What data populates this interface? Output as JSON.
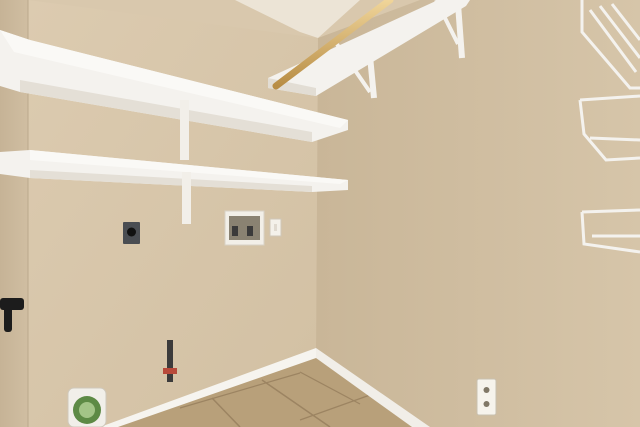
{
  "scene": {
    "subject": "laundry-room",
    "colors": {
      "wall_back": "#d8c6aa",
      "wall_right": "#cfbd9f",
      "wall_left": "#cdbb9e",
      "ceiling": "#ece4d6",
      "shelf": "#f4f2ee",
      "trim": "#f6f4ef",
      "floor_tile": "#b59c76",
      "rod": "#d7b26a"
    },
    "items": [
      "upper-wire-shelf",
      "lower-wire-shelf",
      "closet-rod",
      "corner-wire-shelf",
      "dryer-outlet",
      "washer-valve-box",
      "light-switch",
      "wall-outlet",
      "gas-valve",
      "floor-drain",
      "door-handle",
      "baseboard",
      "tile-floor"
    ]
  }
}
